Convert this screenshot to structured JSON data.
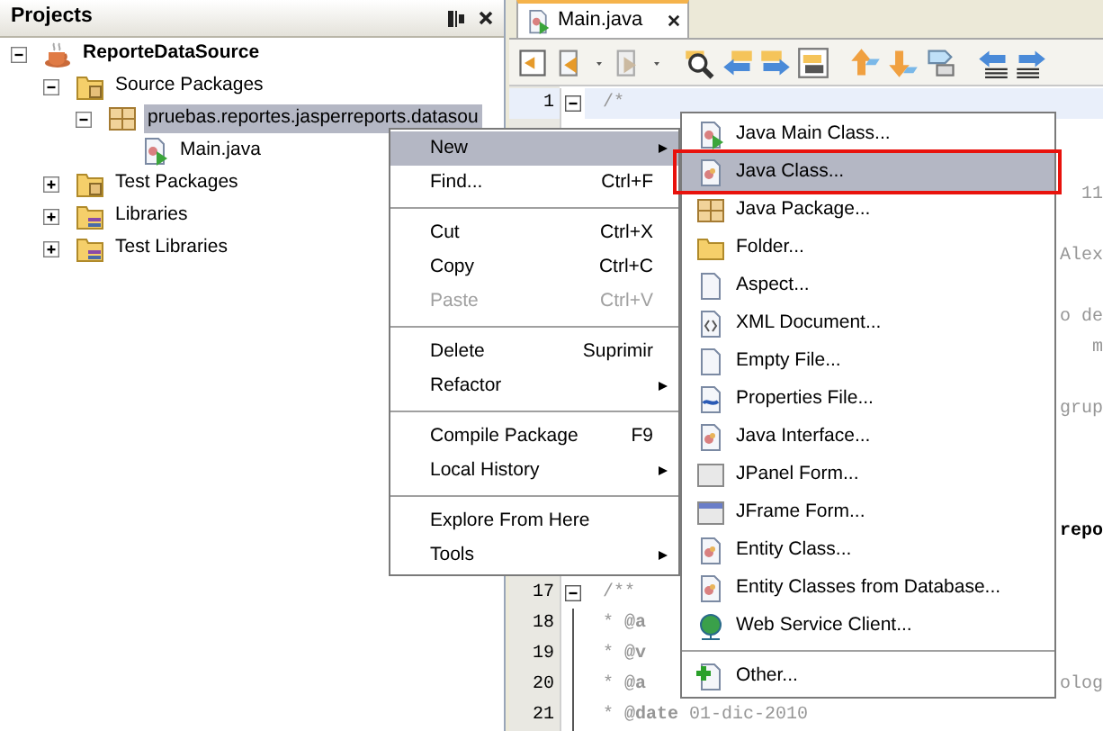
{
  "projects_panel": {
    "title": "Projects",
    "tree": [
      {
        "label": "ReporteDataSource",
        "kind": "project",
        "expanded": true,
        "selected": false,
        "children": [
          {
            "label": "Source Packages",
            "kind": "package-folder",
            "expanded": true,
            "selected": false,
            "children": [
              {
                "label": "pruebas.reportes.jasperreports.datasou",
                "kind": "package",
                "expanded": true,
                "selected": true,
                "children": [
                  {
                    "label": "Main.java",
                    "kind": "java-file",
                    "selected": false
                  }
                ]
              }
            ]
          },
          {
            "label": "Test Packages",
            "kind": "package-folder",
            "expanded": false,
            "selected": false
          },
          {
            "label": "Libraries",
            "kind": "library-folder",
            "expanded": false,
            "selected": false
          },
          {
            "label": "Test Libraries",
            "kind": "library-folder",
            "expanded": false,
            "selected": false
          }
        ]
      }
    ]
  },
  "editor": {
    "tabs": [
      {
        "label": "Main.java",
        "selected": true
      }
    ],
    "lines": [
      {
        "number": "1",
        "fold": true,
        "current": true,
        "text": "/*"
      },
      {
        "number": "17",
        "fold": true,
        "current": false,
        "text": "/**"
      },
      {
        "number": "18",
        "fold": false,
        "current": false,
        "text": "* **@a**"
      },
      {
        "number": "19",
        "fold": false,
        "current": false,
        "text": "* **@v**"
      },
      {
        "number": "20",
        "fold": false,
        "current": false,
        "text": "* **@a**"
      },
      {
        "number": "21",
        "fold": false,
        "current": false,
        "text": "* **@date** 01-dic-2010"
      }
    ],
    "right_edge_fragments": [
      {
        "text": "11",
        "kind": "comment"
      },
      {
        "text": "Alex",
        "kind": "comment"
      },
      {
        "text": "o de",
        "kind": "comment"
      },
      {
        "text": "m",
        "kind": "comment"
      },
      {
        "text": "grup",
        "kind": "comment"
      },
      {
        "text": "repo",
        "kind": "code"
      },
      {
        "text": "olog",
        "kind": "comment"
      }
    ]
  },
  "context_menu": {
    "items": [
      {
        "label": "New",
        "submenu": true,
        "selected": true,
        "disabled": false
      },
      {
        "label": "Find...",
        "shortcut": "Ctrl+F",
        "selected": false,
        "disabled": false
      },
      {
        "kind": "separator"
      },
      {
        "label": "Cut",
        "shortcut": "Ctrl+X",
        "selected": false,
        "disabled": false
      },
      {
        "label": "Copy",
        "shortcut": "Ctrl+C",
        "selected": false,
        "disabled": false
      },
      {
        "label": "Paste",
        "shortcut": "Ctrl+V",
        "selected": false,
        "disabled": true
      },
      {
        "kind": "separator"
      },
      {
        "label": "Delete",
        "shortcut": "Suprimir",
        "selected": false,
        "disabled": false
      },
      {
        "label": "Refactor",
        "submenu": true,
        "selected": false,
        "disabled": false
      },
      {
        "kind": "separator"
      },
      {
        "label": "Compile Package",
        "shortcut": "F9",
        "selected": false,
        "disabled": false
      },
      {
        "label": "Local History",
        "submenu": true,
        "selected": false,
        "disabled": false
      },
      {
        "kind": "separator"
      },
      {
        "label": "Explore From Here",
        "selected": false,
        "disabled": false
      },
      {
        "label": "Tools",
        "submenu": true,
        "selected": false,
        "disabled": false
      }
    ]
  },
  "new_submenu": {
    "items": [
      {
        "label": "Java Main Class...",
        "kind": "java-main",
        "selected": false,
        "outlined": false
      },
      {
        "label": "Java Class...",
        "kind": "java-class",
        "selected": true,
        "outlined": true
      },
      {
        "label": "Java Package...",
        "kind": "package",
        "selected": false,
        "outlined": false
      },
      {
        "label": "Folder...",
        "kind": "folder",
        "selected": false,
        "outlined": false
      },
      {
        "label": "Aspect...",
        "kind": "file",
        "selected": false,
        "outlined": false
      },
      {
        "label": "XML Document...",
        "kind": "xml",
        "selected": false,
        "outlined": false
      },
      {
        "label": "Empty File...",
        "kind": "file",
        "selected": false,
        "outlined": false
      },
      {
        "label": "Properties File...",
        "kind": "properties",
        "selected": false,
        "outlined": false
      },
      {
        "label": "Java Interface...",
        "kind": "java-class",
        "selected": false,
        "outlined": false
      },
      {
        "label": "JPanel Form...",
        "kind": "form",
        "selected": false,
        "outlined": false
      },
      {
        "label": "JFrame Form...",
        "kind": "frame",
        "selected": false,
        "outlined": false
      },
      {
        "label": "Entity Class...",
        "kind": "java-class",
        "selected": false,
        "outlined": false
      },
      {
        "label": "Entity Classes from Database...",
        "kind": "java-class",
        "selected": false,
        "outlined": false
      },
      {
        "label": "Web Service Client...",
        "kind": "web-service",
        "selected": false,
        "outlined": false
      },
      {
        "kind": "separator"
      },
      {
        "label": "Other...",
        "kind": "other",
        "selected": false,
        "outlined": false
      }
    ]
  }
}
